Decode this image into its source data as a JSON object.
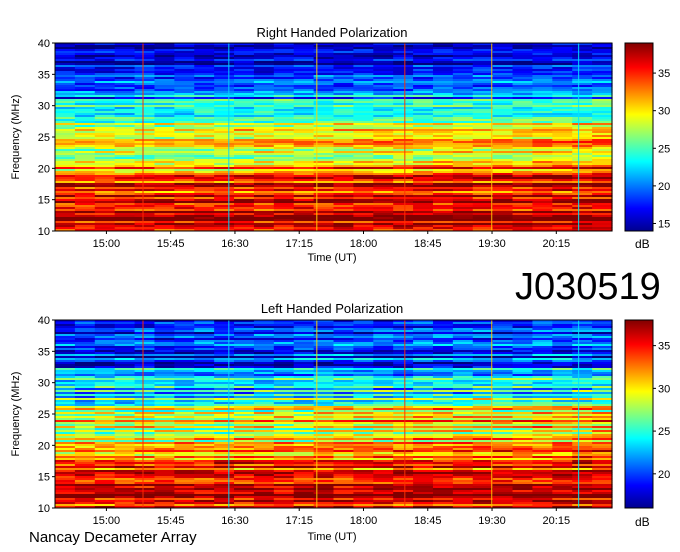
{
  "figure": {
    "observation_id": "J030519",
    "instrument_label": "Nancay Decameter Array"
  },
  "chart_data": [
    {
      "type": "heatmap",
      "title": "Right Handed Polarization",
      "xlabel": "Time (UT)",
      "ylabel": "Frequency (MHz)",
      "x_ticks": [
        "15:00",
        "15:45",
        "16:30",
        "17:15",
        "18:00",
        "18:45",
        "19:30",
        "20:15"
      ],
      "y_ticks": [
        10,
        15,
        20,
        25,
        30,
        35,
        40
      ],
      "ylim": [
        10,
        40
      ],
      "colorbar": {
        "label": "dB",
        "ticks": [
          15,
          20,
          25,
          30,
          35
        ],
        "range": [
          14,
          39
        ]
      },
      "intensity_profile_db": [
        {
          "freq": 10,
          "db": 36
        },
        {
          "freq": 12,
          "db": 37
        },
        {
          "freq": 14,
          "db": 36
        },
        {
          "freq": 16,
          "db": 35
        },
        {
          "freq": 18,
          "db": 34
        },
        {
          "freq": 20,
          "db": 31
        },
        {
          "freq": 22,
          "db": 28
        },
        {
          "freq": 24,
          "db": 30
        },
        {
          "freq": 26,
          "db": 29
        },
        {
          "freq": 28,
          "db": 24
        },
        {
          "freq": 30,
          "db": 23
        },
        {
          "freq": 32,
          "db": 20
        },
        {
          "freq": 34,
          "db": 18
        },
        {
          "freq": 36,
          "db": 18
        },
        {
          "freq": 38,
          "db": 16
        },
        {
          "freq": 40,
          "db": 15
        }
      ]
    },
    {
      "type": "heatmap",
      "title": "Left Handed Polarization",
      "xlabel": "Time (UT)",
      "ylabel": "Frequency (MHz)",
      "x_ticks": [
        "15:00",
        "15:45",
        "16:30",
        "17:15",
        "18:00",
        "18:45",
        "19:30",
        "20:15"
      ],
      "y_ticks": [
        10,
        15,
        20,
        25,
        30,
        35,
        40
      ],
      "ylim": [
        10,
        40
      ],
      "colorbar": {
        "label": "dB",
        "ticks": [
          20,
          25,
          30,
          35
        ],
        "range": [
          16,
          38
        ]
      },
      "intensity_profile_db": [
        {
          "freq": 10,
          "db": 35
        },
        {
          "freq": 12,
          "db": 36
        },
        {
          "freq": 14,
          "db": 35
        },
        {
          "freq": 16,
          "db": 34
        },
        {
          "freq": 18,
          "db": 33
        },
        {
          "freq": 20,
          "db": 30
        },
        {
          "freq": 22,
          "db": 27
        },
        {
          "freq": 24,
          "db": 29
        },
        {
          "freq": 26,
          "db": 28
        },
        {
          "freq": 28,
          "db": 24
        },
        {
          "freq": 30,
          "db": 23
        },
        {
          "freq": 32,
          "db": 21
        },
        {
          "freq": 34,
          "db": 19
        },
        {
          "freq": 36,
          "db": 19
        },
        {
          "freq": 38,
          "db": 18
        },
        {
          "freq": 40,
          "db": 17
        }
      ]
    }
  ]
}
